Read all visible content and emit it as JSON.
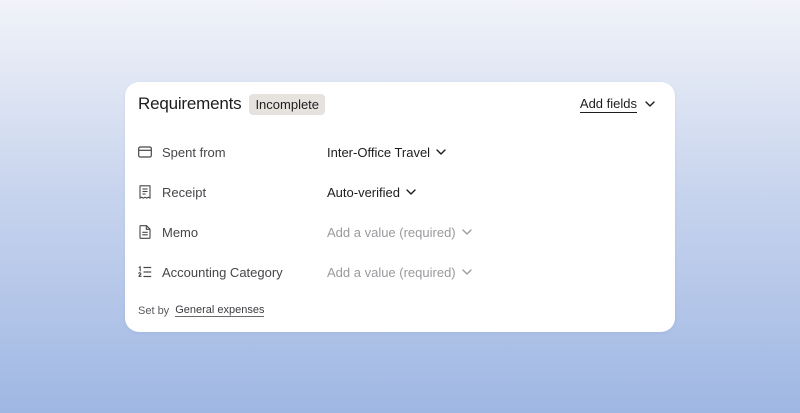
{
  "header": {
    "title": "Requirements",
    "status_badge": "Incomplete",
    "add_fields_label": "Add fields"
  },
  "fields": [
    {
      "label": "Spent from",
      "value": "Inter-Office Travel",
      "icon": "card-icon",
      "state": "filled"
    },
    {
      "label": "Receipt",
      "value": "Auto-verified",
      "icon": "receipt-icon",
      "state": "filled"
    },
    {
      "label": "Memo",
      "value": "Add a value (required)",
      "icon": "document-icon",
      "state": "empty"
    },
    {
      "label": "Accounting Category",
      "value": "Add a value (required)",
      "icon": "numbered-list-icon",
      "state": "empty"
    }
  ],
  "footer": {
    "prefix": "Set by",
    "link": "General expenses"
  },
  "colors": {
    "badge_bg": "#e6e3df",
    "text_primary": "#1d1d1f",
    "text_placeholder": "#9a9a9e"
  }
}
